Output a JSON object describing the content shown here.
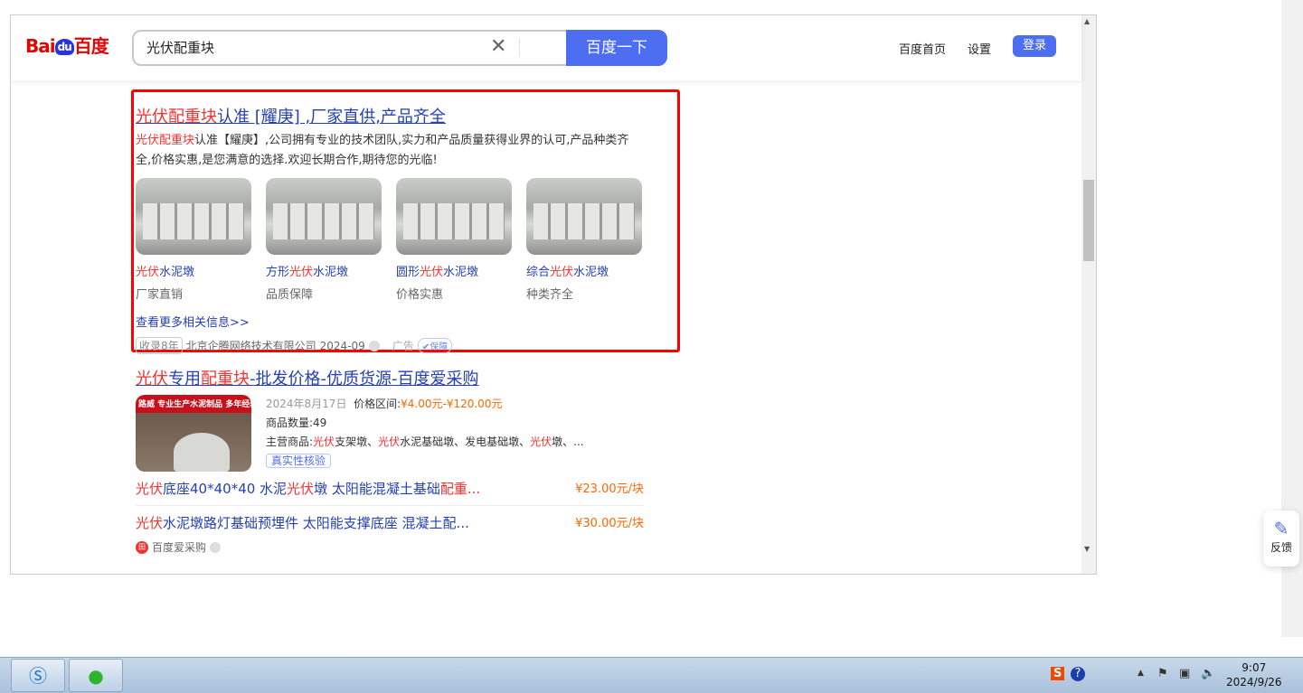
{
  "header": {
    "logo": "Bai百度",
    "logo_du": "du",
    "query": "光伏配重块",
    "search_button": "百度一下",
    "links": [
      "百度首页",
      "设置"
    ],
    "login": "登录"
  },
  "ad_result": {
    "title": [
      {
        "t": "光伏配重块",
        "h": true
      },
      {
        "t": "认准 [耀庚] ,厂家直供,产品齐全",
        "h": false
      }
    ],
    "desc": [
      {
        "t": "光伏配重块",
        "h": true
      },
      {
        "t": "认准【耀庚】,公司拥有专业的技术团队,实力和产品质量获得业界的认可,产品种类齐全,价格实惠,是您满意的选择.欢迎长期合作,期待您的光临!",
        "h": false
      }
    ],
    "cards": [
      {
        "pre": "",
        "hl": "光伏",
        "post": "水泥墩",
        "sub": "厂家直销"
      },
      {
        "pre": "方形",
        "hl": "光伏",
        "post": "水泥墩",
        "sub": "品质保障"
      },
      {
        "pre": "圆形",
        "hl": "光伏",
        "post": "水泥墩",
        "sub": "价格实惠"
      },
      {
        "pre": "综合",
        "hl": "光伏",
        "post": "水泥墩",
        "sub": "种类齐全"
      }
    ],
    "more": "查看更多相关信息>>",
    "years_tag": "收录8年",
    "company": "北京企腾网络技术有限公司",
    "date": "2024-09",
    "ad_label": "广告",
    "guarantee": "保障"
  },
  "aicaigou_result": {
    "title": [
      {
        "t": "光伏",
        "h": true
      },
      {
        "t": "专用",
        "h": false
      },
      {
        "t": "配重块",
        "h": true
      },
      {
        "t": "-批发价格-优质货源-百度爱采购",
        "h": false
      }
    ],
    "image_caption": "路威 专业生产水泥制品 多年经验",
    "date": "2024年8月17日",
    "price_label": "价格区间:",
    "price_range": "¥4.00元-¥120.00元",
    "count_label": "商品数量:",
    "count": "49",
    "main_label": "主营商品:",
    "main": [
      {
        "t": "光伏",
        "h": true
      },
      {
        "t": "支架墩、",
        "h": false
      },
      {
        "t": "光伏",
        "h": true
      },
      {
        "t": "水泥基础墩、发电基础墩、",
        "h": false
      },
      {
        "t": "光伏",
        "h": true
      },
      {
        "t": "墩、...",
        "h": false
      }
    ],
    "verify": "真实性核验",
    "products": [
      {
        "segs": [
          {
            "t": "光伏",
            "h": true
          },
          {
            "t": "底座40*40*40 水泥",
            "h": false
          },
          {
            "t": "光伏",
            "h": true
          },
          {
            "t": "墩 太阳能混凝土基础",
            "h": false
          },
          {
            "t": "配重...",
            "h": true
          }
        ],
        "price": "¥23.00元/块"
      },
      {
        "segs": [
          {
            "t": "光伏",
            "h": true
          },
          {
            "t": "水泥墩路灯基础预埋件 太阳能支撑底座 混凝土配...",
            "h": false
          }
        ],
        "price": "¥30.00元/块"
      }
    ],
    "source": "百度爱采购"
  },
  "feedback": "反馈",
  "taskbar": {
    "time": "9:07",
    "date": "2024/9/26"
  }
}
